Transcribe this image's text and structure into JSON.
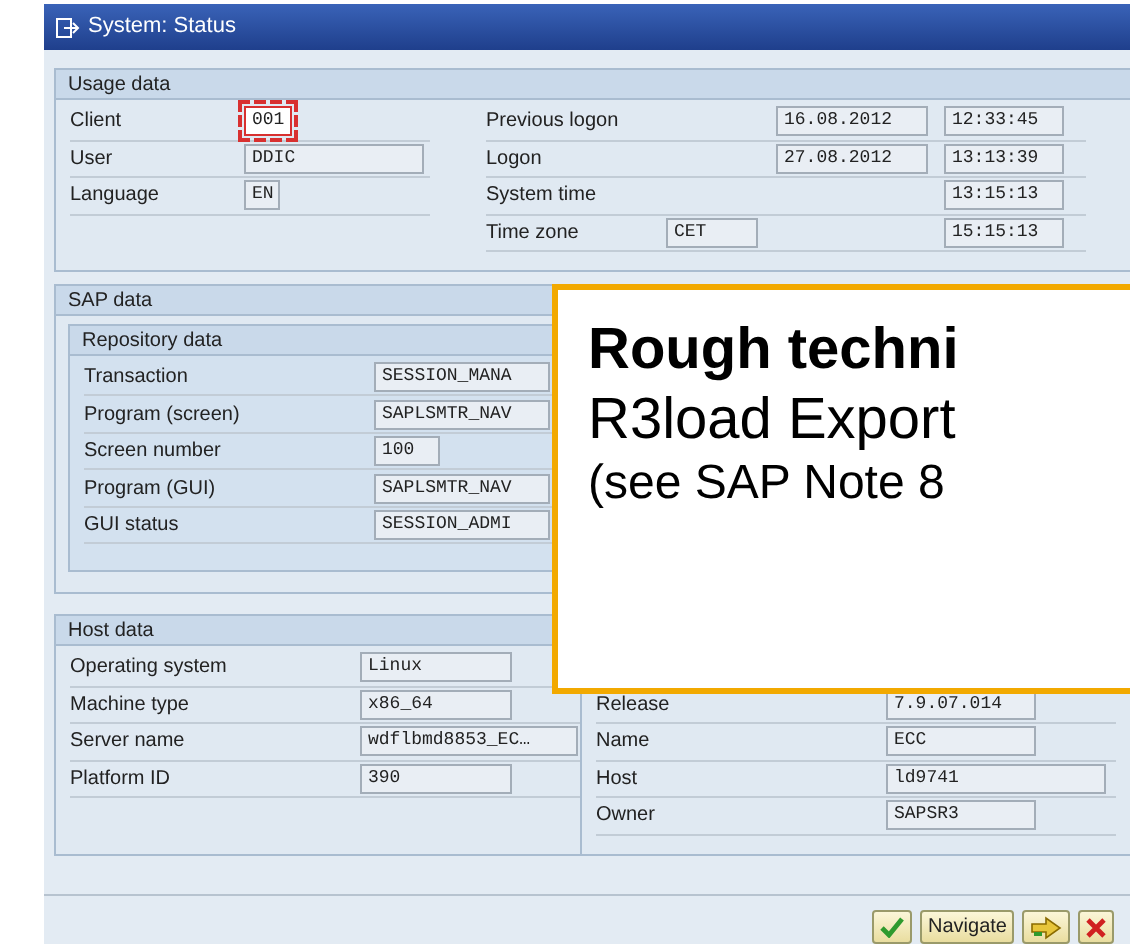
{
  "window": {
    "title": "System: Status"
  },
  "usage_data": {
    "title": "Usage data",
    "left": [
      {
        "label": "Client",
        "value": "001",
        "focused": true
      },
      {
        "label": "User",
        "value": "DDIC",
        "focused": false
      },
      {
        "label": "Language",
        "value": "EN",
        "focused": false
      }
    ],
    "right": [
      {
        "label": "Previous logon",
        "date": "16.08.2012",
        "time": "12:33:45"
      },
      {
        "label": "Logon",
        "date": "27.08.2012",
        "time": "13:13:39"
      },
      {
        "label": "System time",
        "time": "13:15:13"
      },
      {
        "label": "Time zone",
        "zone": "CET",
        "time": "15:15:13"
      }
    ]
  },
  "sap_data": {
    "title": "SAP data",
    "repository": {
      "title": "Repository data",
      "rows": [
        {
          "label": "Transaction",
          "value": "SESSION_MANA"
        },
        {
          "label": "Program (screen)",
          "value": "SAPLSMTR_NAV"
        },
        {
          "label": "Screen number",
          "value": "100"
        },
        {
          "label": "Program (GUI)",
          "value": "SAPLSMTR_NAV"
        },
        {
          "label": "GUI status",
          "value": "SESSION_ADMI"
        }
      ]
    }
  },
  "host_data": {
    "title": "Host data",
    "left": [
      {
        "label": "Operating system",
        "value": "Linux"
      },
      {
        "label": "Machine type",
        "value": "x86_64"
      },
      {
        "label": "Server name",
        "value": "wdflbmd8853_EC…"
      },
      {
        "label": "Platform ID",
        "value": "390"
      }
    ],
    "right": [
      {
        "label": "Release",
        "value": "7.9.07.014"
      },
      {
        "label": "Name",
        "value": "ECC"
      },
      {
        "label": "Host",
        "value": "ld9741"
      },
      {
        "label": "Owner",
        "value": "SAPSR3"
      }
    ]
  },
  "callout": {
    "title": "Rough techni",
    "lines": [
      "R3load Export",
      "(see SAP Note 8"
    ]
  },
  "footer": {
    "buttons": [
      {
        "kind": "check"
      },
      {
        "kind": "text",
        "label": "Navigate"
      },
      {
        "kind": "arrow"
      },
      {
        "kind": "cancel"
      }
    ]
  }
}
